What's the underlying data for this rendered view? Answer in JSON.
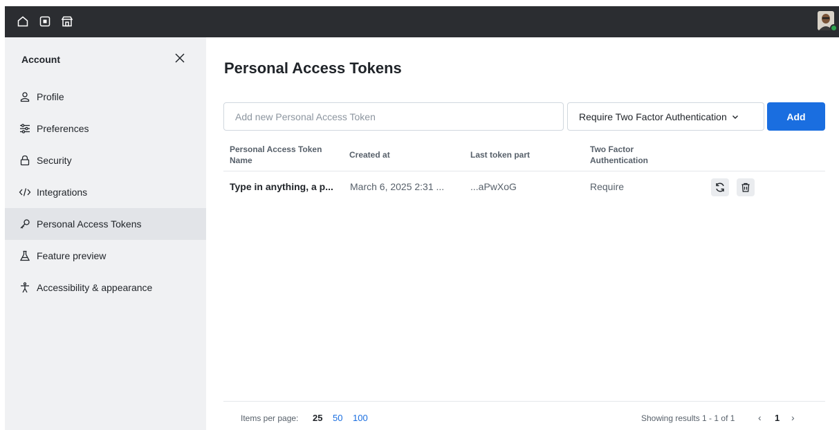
{
  "topbar": {
    "icons": [
      "home-icon",
      "dashboard-icon",
      "store-icon"
    ],
    "avatar": "user-avatar"
  },
  "sidebar": {
    "title": "Account",
    "items": [
      {
        "label": "Profile",
        "icon": "person-icon"
      },
      {
        "label": "Preferences",
        "icon": "sliders-icon"
      },
      {
        "label": "Security",
        "icon": "lock-icon"
      },
      {
        "label": "Integrations",
        "icon": "code-icon"
      },
      {
        "label": "Personal Access Tokens",
        "icon": "key-icon",
        "active": true
      },
      {
        "label": "Feature preview",
        "icon": "flask-icon"
      },
      {
        "label": "Accessibility & appearance",
        "icon": "accessibility-icon"
      }
    ]
  },
  "page": {
    "title": "Personal Access Tokens"
  },
  "form": {
    "placeholder": "Add new Personal Access Token",
    "select_value": "Require Two Factor Authentication",
    "add_label": "Add"
  },
  "table": {
    "headers": {
      "name": "Personal Access Token Name",
      "created": "Created at",
      "last_part": "Last token part",
      "two_factor": "Two Factor Authentication"
    },
    "rows": [
      {
        "name": "Type in anything, a p...",
        "created": "March 6, 2025 2:31 ...",
        "last_part": "...aPwXoG",
        "two_factor": "Require"
      }
    ]
  },
  "footer": {
    "items_per_page_label": "Items per page:",
    "page_sizes": [
      "25",
      "50",
      "100"
    ],
    "showing": "Showing results 1 - 1 of 1",
    "current_page": "1"
  },
  "colors": {
    "accent": "#1a6ee0",
    "topbar": "#2b2d31",
    "sidebar": "#f0f1f3",
    "online": "#2ea44f"
  }
}
